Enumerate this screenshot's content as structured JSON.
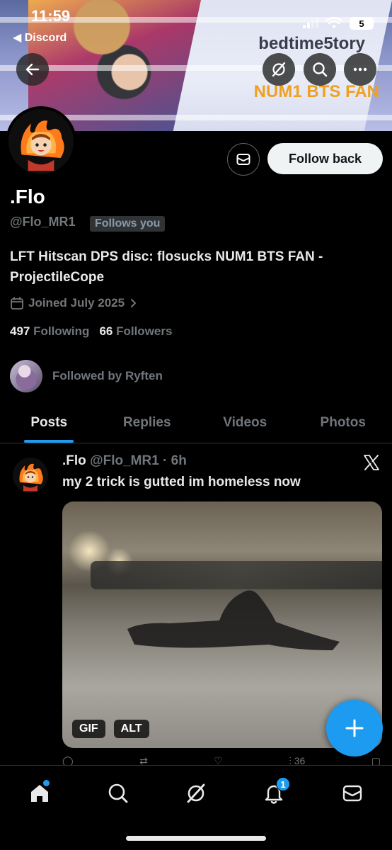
{
  "status_bar": {
    "time": "11:59",
    "back_app": "◀ Discord",
    "battery": "5"
  },
  "banner": {
    "name_text": "bedtime5tory",
    "tag_text": "NUM1 BTS FAN"
  },
  "profile": {
    "follow_button": "Follow back",
    "display_name": ".Flo",
    "handle": "@Flo_MR1",
    "follows_you": "Follows you",
    "bio": "LFT Hitscan DPS disc: flosucks NUM1 BTS FAN - ProjectileCope",
    "joined": "Joined July 2025",
    "following_count": "497",
    "following_label": "Following",
    "followers_count": "66",
    "followers_label": "Followers",
    "followed_by": "Followed by Ryften"
  },
  "tabs": [
    {
      "label": "Posts",
      "active": true
    },
    {
      "label": "Replies",
      "active": false
    },
    {
      "label": "Videos",
      "active": false
    },
    {
      "label": "Photos",
      "active": false
    }
  ],
  "post": {
    "name": ".Flo",
    "meta": "@Flo_MR1 · 6h",
    "text": "my 2 trick is gutted im homeless now",
    "badges": {
      "gif": "GIF",
      "alt": "ALT"
    },
    "view_count": "36"
  },
  "bottom_nav": {
    "items": [
      "home-icon",
      "search-icon",
      "grok-icon",
      "bell-icon",
      "mail-icon"
    ],
    "notification_count": "1"
  },
  "colors": {
    "accent": "#1d9bf0",
    "background": "#000000",
    "muted": "#71767b"
  }
}
